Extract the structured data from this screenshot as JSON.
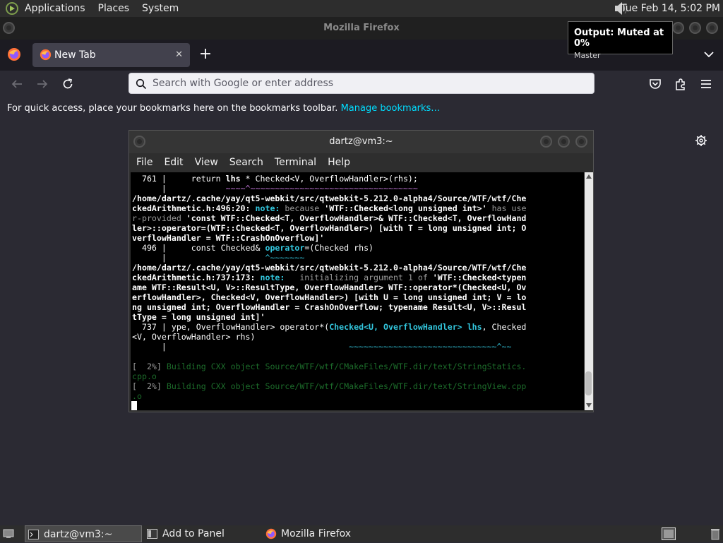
{
  "top_panel": {
    "menus": [
      "Applications",
      "Places",
      "System"
    ],
    "clock": "Tue Feb 14,  5:02 PM"
  },
  "window": {
    "title": "Mozilla Firefox"
  },
  "tabs": [
    {
      "label": "New Tab",
      "close": "✕"
    }
  ],
  "new_tab_glyph": "+",
  "urlbar": {
    "placeholder": "Search with Google or enter address"
  },
  "bookmarks_bar": {
    "text": "For quick access, place your bookmarks here on the bookmarks toolbar.",
    "link": "Manage bookmarks…"
  },
  "notification": {
    "title": "Output: Muted at 0%",
    "subtitle": "Master"
  },
  "terminal": {
    "title": "dartz@vm3:~",
    "menu": [
      "File",
      "Edit",
      "View",
      "Search",
      "Terminal",
      "Help"
    ],
    "lines": [
      [
        [
          "  761 |     return ",
          ""
        ],
        [
          "lhs",
          "b"
        ],
        [
          " * ",
          ""
        ],
        [
          "Checked<V, OverflowHandler>",
          ""
        ],
        [
          "(rhs);",
          ""
        ]
      ],
      [
        [
          "      |            ",
          ""
        ],
        [
          "~~~~^~~~~~~~~~~~~~~~~~~~~~~~~~~~~~~~~~~",
          "mg"
        ]
      ],
      [
        [
          "/home/dartz/.cache/yay/qt5-webkit/src/qtwebkit-5.212.0-alpha4/Source/WTF/wtf/Che",
          "b"
        ]
      ],
      [
        [
          "ckedArithmetic.h:496:20: ",
          "b"
        ],
        [
          "note:",
          "b cy"
        ],
        [
          " because ",
          "gr"
        ],
        [
          "'WTF::Checked<long unsigned int>'",
          "b"
        ],
        [
          " has use",
          "gr"
        ]
      ],
      [
        [
          "r-provided ",
          "gr"
        ],
        [
          "'const WTF::Checked<T, OverflowHandler>& WTF::Checked<T, OverflowHand",
          "b"
        ]
      ],
      [
        [
          "ler>::operator=(WTF::Checked<T, OverflowHandler>) [with T = long unsigned int; O",
          "b"
        ]
      ],
      [
        [
          "verflowHandler = WTF::CrashOnOverflow]'",
          "b"
        ]
      ],
      [
        [
          "  496 |     const Checked& ",
          ""
        ],
        [
          "operator",
          "b cy"
        ],
        [
          "=(Checked rhs)",
          ""
        ]
      ],
      [
        [
          "      |                    ",
          ""
        ],
        [
          "^~~~~~~~",
          "cy"
        ]
      ],
      [
        [
          "/home/dartz/.cache/yay/qt5-webkit/src/qtwebkit-5.212.0-alpha4/Source/WTF/wtf/Che",
          "b"
        ]
      ],
      [
        [
          "ckedArithmetic.h:737:173: ",
          "b"
        ],
        [
          "note:",
          "b cy"
        ],
        [
          "   initializing argument 1 of ",
          "gr"
        ],
        [
          "'WTF::Checked<typen",
          "b"
        ]
      ],
      [
        [
          "ame WTF::Result<U, V>::ResultType, OverflowHandler> WTF::operator*(Checked<U, Ov",
          "b"
        ]
      ],
      [
        [
          "erflowHandler>, Checked<V, OverflowHandler>) [with U = long unsigned int; V = lo",
          "b"
        ]
      ],
      [
        [
          "ng unsigned int; OverflowHandler = CrashOnOverflow; typename Result<U, V>::Resul",
          "b"
        ]
      ],
      [
        [
          "tType = long unsigned int]'",
          "b"
        ]
      ],
      [
        [
          "  737 | ype, OverflowHandler> operator*(",
          ""
        ],
        [
          "Checked<U, OverflowHandler> lhs",
          "b cy"
        ],
        [
          ", Checked",
          ""
        ]
      ],
      [
        [
          "<V, OverflowHandler> rhs)",
          ""
        ]
      ],
      [
        [
          "      |                                     ",
          ""
        ],
        [
          "~~~~~~~~~~~~~~~~~~~~~~~~~~~~~~^~~",
          "cy"
        ]
      ],
      [
        [
          "",
          ""
        ]
      ],
      [
        [
          "[  2%] ",
          "gr"
        ],
        [
          "Building CXX object Source/WTF/wtf/CMakeFiles/WTF.dir/text/StringStatics.",
          "dg"
        ]
      ],
      [
        [
          "cpp.o",
          "dg"
        ]
      ],
      [
        [
          "[  2%] ",
          "gr"
        ],
        [
          "Building CXX object Source/WTF/wtf/CMakeFiles/WTF.dir/text/StringView.cpp",
          "dg"
        ]
      ],
      [
        [
          ".o",
          "dg"
        ]
      ]
    ]
  },
  "taskbar": {
    "tasks": [
      "dartz@vm3:~",
      "Add to Panel",
      "Mozilla Firefox"
    ]
  },
  "icons": {
    "apps_logo": "apps-logo",
    "speaker": "speaker-muted-icon",
    "firefox": "firefox-icon",
    "search": "search-icon",
    "back": "back-arrow-icon",
    "forward": "forward-arrow-icon",
    "reload": "reload-icon",
    "pocket": "pocket-icon",
    "extensions": "extensions-icon",
    "hamburger": "hamburger-menu-icon",
    "gear": "gear-icon",
    "chevron": "chevron-down-icon"
  }
}
